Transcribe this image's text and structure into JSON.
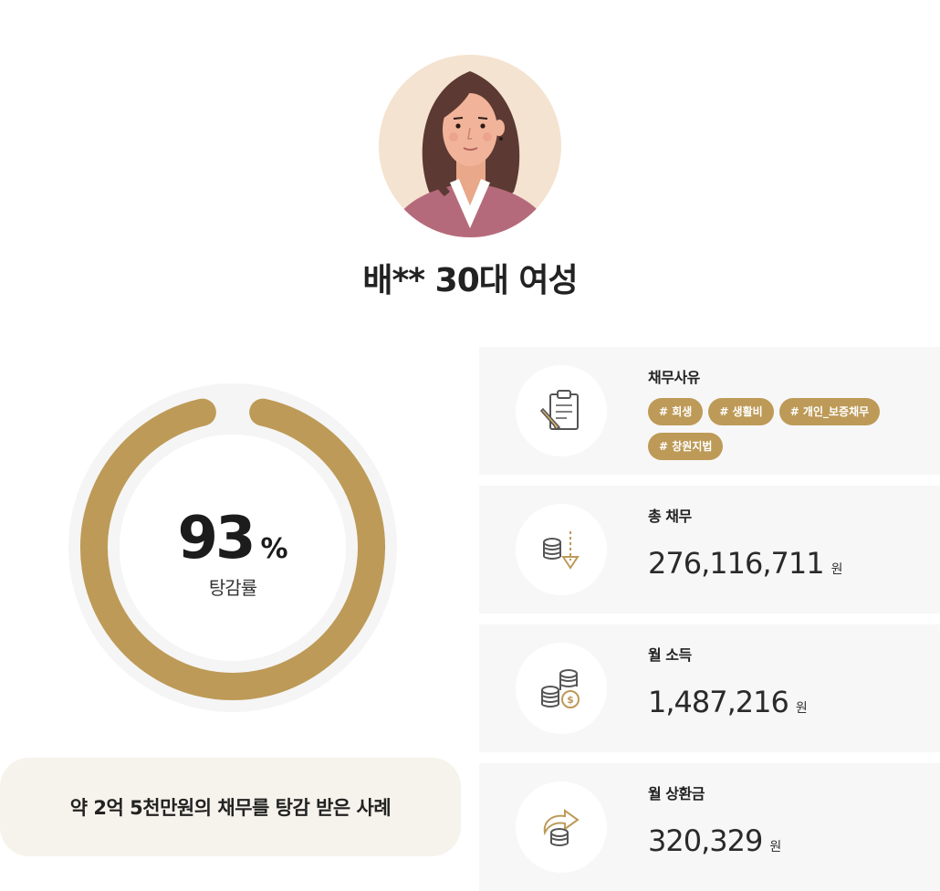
{
  "profile": {
    "name": "배** 30대 여성"
  },
  "result": {
    "percent": "93",
    "percent_unit": "%",
    "percent_value": 93,
    "label": "탕감률"
  },
  "summary": "약 2억 5천만원의 채무를 탕감 받은 사례",
  "cards": {
    "reason": {
      "title": "채무사유",
      "icon": "clipboard-pencil-icon",
      "tags": [
        "# 회생",
        "# 생활비",
        "# 개인_보증채무",
        "# 창원지법"
      ]
    },
    "total_debt": {
      "title": "총 채무",
      "icon": "coins-down-arrow-icon",
      "amount": "276,116,711",
      "unit": "원"
    },
    "monthly_income": {
      "title": "월 소득",
      "icon": "coins-stack-icon",
      "amount": "1,487,216",
      "unit": "원"
    },
    "monthly_repayment": {
      "title": "월 상환금",
      "icon": "coins-return-arrow-icon",
      "amount": "320,329",
      "unit": "원"
    }
  },
  "colors": {
    "accent": "#bd9a57",
    "ring_track": "#f5f5f5",
    "card_bg": "#f7f7f7",
    "summary_bg": "#f6f3ec",
    "avatar_bg": "#f4e3d0"
  }
}
